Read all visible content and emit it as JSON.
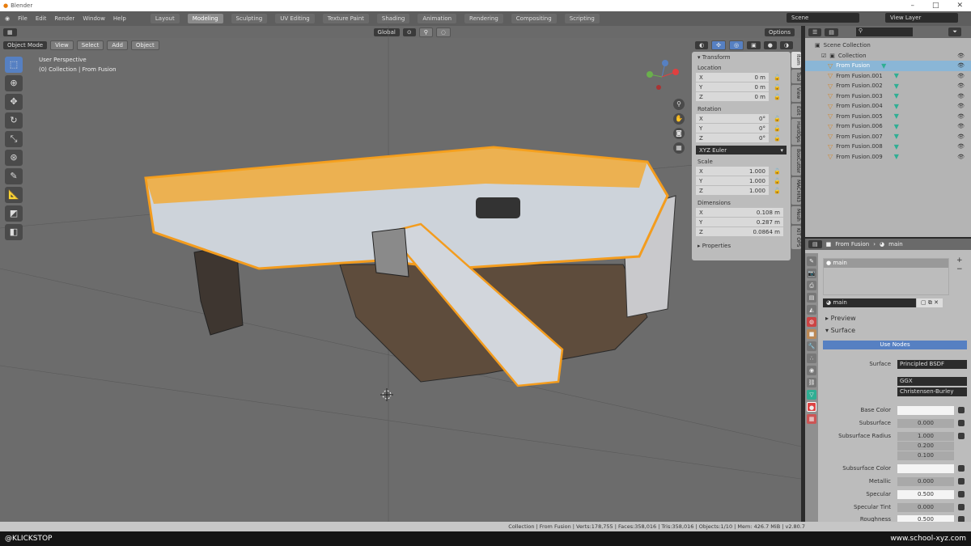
{
  "app": {
    "title": "Blender"
  },
  "menu": [
    "File",
    "Edit",
    "Render",
    "Window",
    "Help"
  ],
  "workspaces": [
    "Layout",
    "Modeling",
    "Sculpting",
    "UV Editing",
    "Texture Paint",
    "Shading",
    "Animation",
    "Rendering",
    "Compositing",
    "Scripting"
  ],
  "active_workspace": "Modeling",
  "scene": "Scene",
  "view_layer": "View Layer",
  "viewport": {
    "mode": "Object Mode",
    "menus": [
      "View",
      "Select",
      "Add",
      "Object"
    ],
    "orientation": "Global",
    "options": "Options",
    "overlay_title": "User Perspective",
    "overlay_sub": "(0) Collection | From Fusion"
  },
  "npanel": {
    "title": "Transform",
    "location_label": "Location",
    "location": [
      {
        "axis": "X",
        "value": "0 m"
      },
      {
        "axis": "Y",
        "value": "0 m"
      },
      {
        "axis": "Z",
        "value": "0 m"
      }
    ],
    "rotation_label": "Rotation",
    "rotation": [
      {
        "axis": "X",
        "value": "0°"
      },
      {
        "axis": "Y",
        "value": "0°"
      },
      {
        "axis": "Z",
        "value": "0°"
      }
    ],
    "rotation_mode": "XYZ Euler",
    "scale_label": "Scale",
    "scale": [
      {
        "axis": "X",
        "value": "1.000"
      },
      {
        "axis": "Y",
        "value": "1.000"
      },
      {
        "axis": "Z",
        "value": "1.000"
      }
    ],
    "dimensions_label": "Dimensions",
    "dimensions": [
      {
        "axis": "X",
        "value": "0.108 m"
      },
      {
        "axis": "Y",
        "value": "0.287 m"
      },
      {
        "axis": "Z",
        "value": "0.0864 m"
      }
    ],
    "properties": "Properties",
    "tabs": [
      "Item",
      "Tool",
      "View",
      "Edit",
      "HardOps",
      "BoxCutter",
      "MACHIN3",
      "Mesh",
      "KIT OPS"
    ]
  },
  "outliner": {
    "root": "Scene Collection",
    "collection": "Collection",
    "objects": [
      "From Fusion",
      "From Fusion.001",
      "From Fusion.002",
      "From Fusion.003",
      "From Fusion.004",
      "From Fusion.005",
      "From Fusion.006",
      "From Fusion.007",
      "From Fusion.008",
      "From Fusion.009"
    ]
  },
  "properties": {
    "breadcrumb_object": "From Fusion",
    "breadcrumb_material": "main",
    "slot": "main",
    "material_name": "main",
    "preview": "Preview",
    "surface_section": "Surface",
    "use_nodes": "Use Nodes",
    "surface_label": "Surface",
    "surface_value": "Principled BSDF",
    "distribution": "GGX",
    "subsurface_method": "Christensen-Burley",
    "rows": [
      {
        "label": "Base Color",
        "value": "",
        "white": true
      },
      {
        "label": "Subsurface",
        "value": "0.000"
      },
      {
        "label": "Subsurface Radius",
        "value": "1.000"
      },
      {
        "label": "",
        "value": "0.200"
      },
      {
        "label": "",
        "value": "0.100"
      },
      {
        "label": "Subsurface Color",
        "value": "",
        "white": true
      },
      {
        "label": "Metallic",
        "value": "0.000"
      },
      {
        "label": "Specular",
        "value": "0.500",
        "white": true
      },
      {
        "label": "Specular Tint",
        "value": "0.000"
      },
      {
        "label": "Roughness",
        "value": "0.500",
        "white": true
      }
    ]
  },
  "status": "Collection | From Fusion | Verts:178,755 | Faces:358,016 | Tris:358,016 | Objects:1/10 | Mem: 426.7 MiB | v2.80.7",
  "footer": {
    "left": "@KLICKSTOP",
    "right": "www.school-xyz.com"
  },
  "colors": {
    "selection": "#f5a623",
    "accent": "#5680c2"
  }
}
